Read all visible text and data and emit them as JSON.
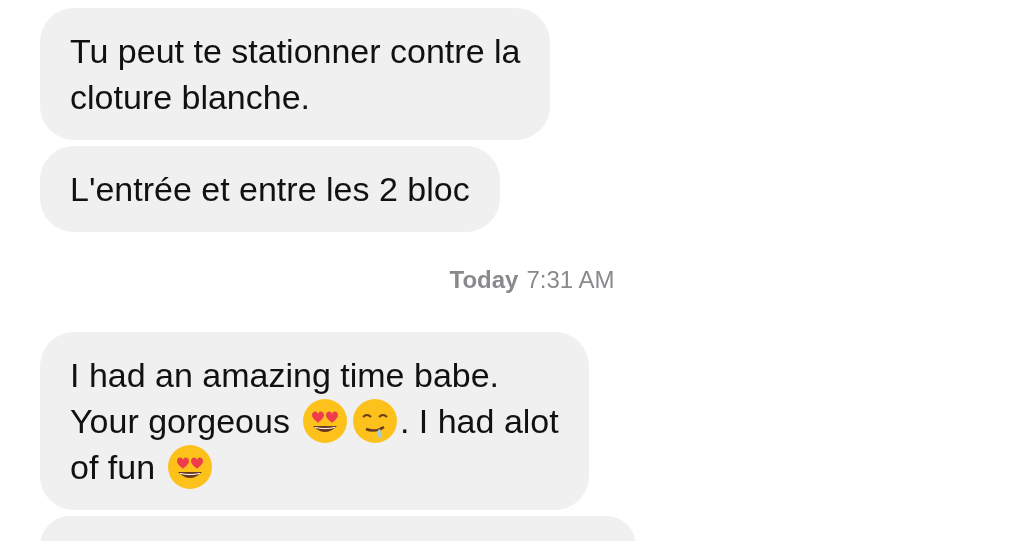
{
  "messages_before": [
    {
      "kind": "bubble",
      "text": "Tu peut te stationner contre la\ncloture blanche."
    },
    {
      "kind": "bubble",
      "text": "L'entrée et entre les 2 bloc"
    }
  ],
  "timestamp": {
    "day": "Today",
    "time": "7:31 AM"
  },
  "messages_after": [
    {
      "kind": "mixed",
      "lines": [
        [
          {
            "kind": "text",
            "text": "I had an amazing time babe."
          }
        ],
        [
          {
            "kind": "text",
            "text": "Your gorgeous"
          },
          {
            "kind": "heart-eyes"
          },
          {
            "kind": "drooling"
          },
          {
            "kind": "text",
            "text": ". I had alot"
          }
        ],
        [
          {
            "kind": "text",
            "text": "of fun"
          },
          {
            "kind": "heart-eyes"
          }
        ]
      ]
    },
    {
      "kind": "cut-off"
    }
  ]
}
